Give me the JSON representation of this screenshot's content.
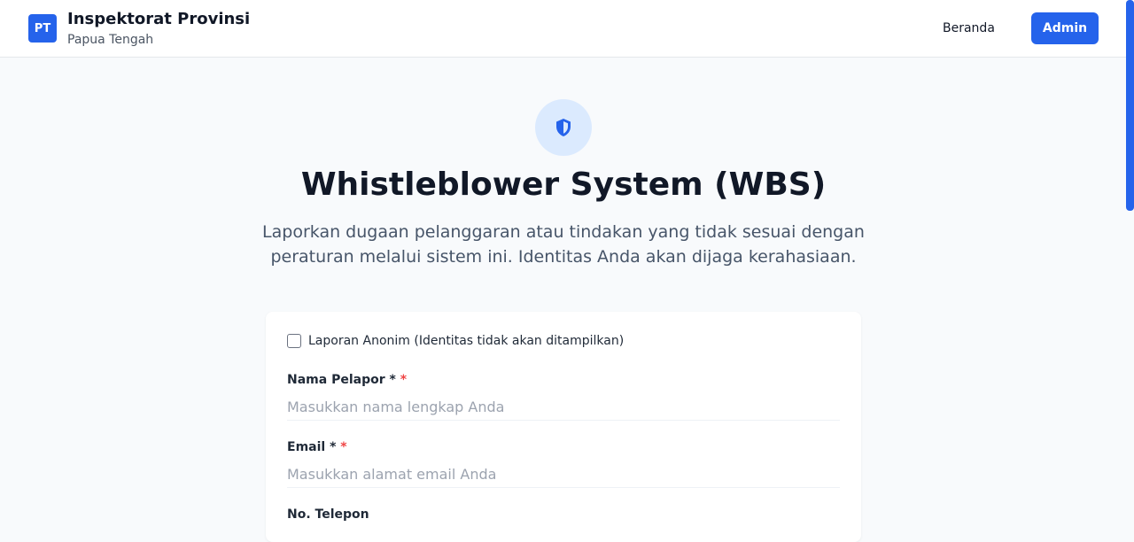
{
  "header": {
    "logo_text": "PT",
    "title": "Inspektorat Provinsi",
    "subtitle": "Papua Tengah",
    "nav_home": "Beranda",
    "nav_admin": "Admin"
  },
  "hero": {
    "icon": "shield-icon",
    "title": "Whistleblower System (WBS)",
    "description": "Laporkan dugaan pelanggaran atau tindakan yang tidak sesuai dengan peraturan melalui sistem ini. Identitas Anda akan dijaga kerahasiaan."
  },
  "form": {
    "anonymous_label": "Laporan Anonim (Identitas tidak akan ditampilkan)",
    "anonymous_checked": false,
    "name": {
      "label": "Nama Pelapor *",
      "required_mark": "*",
      "placeholder": "Masukkan nama lengkap Anda",
      "value": ""
    },
    "email": {
      "label": "Email *",
      "required_mark": "*",
      "placeholder": "Masukkan alamat email Anda",
      "value": ""
    },
    "phone": {
      "label": "No. Telepon"
    }
  },
  "colors": {
    "primary": "#2563eb",
    "background": "#f8fafc",
    "required": "#ef4444"
  }
}
